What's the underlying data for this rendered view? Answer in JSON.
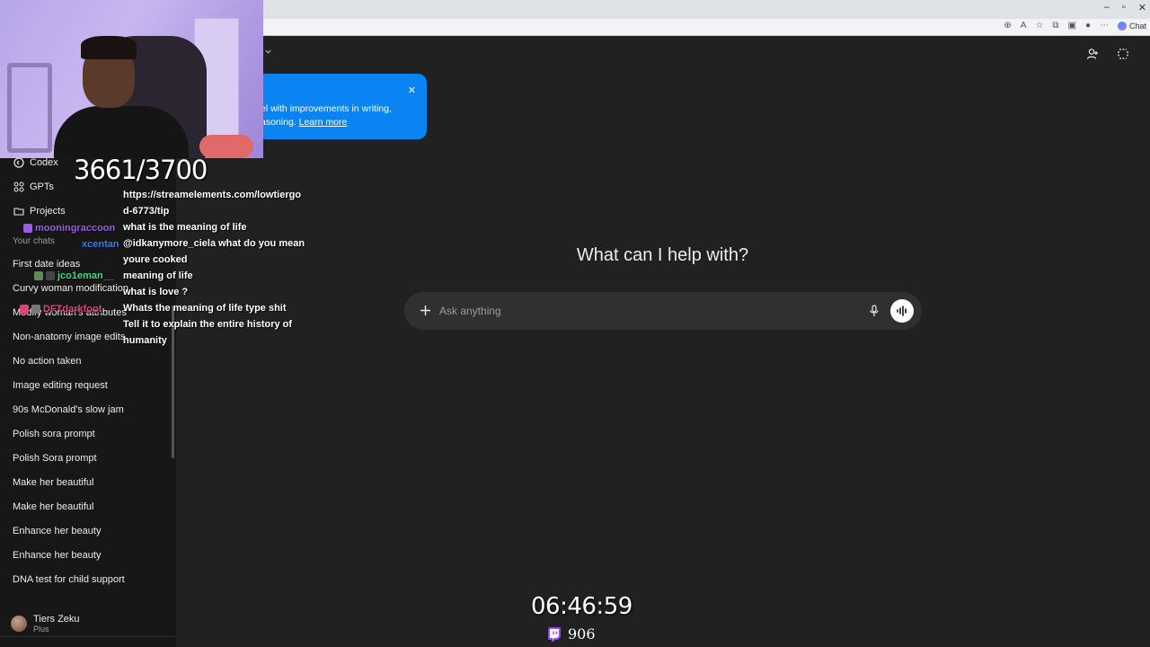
{
  "browser": {
    "window_controls": [
      "–",
      "▫",
      "✕"
    ],
    "chat_button_label": "Chat"
  },
  "sidebar": {
    "nav": [
      {
        "label": "Codex",
        "icon": "codex-icon"
      },
      {
        "label": "GPTs",
        "icon": "gpts-grid-icon"
      },
      {
        "label": "Projects",
        "icon": "folder-icon"
      }
    ],
    "section_title": "Your chats",
    "chats": [
      "First date ideas",
      "Curvy woman modification",
      "Modify woman's attributes",
      "Non-anatomy image edits",
      "No action taken",
      "Image editing request",
      "90s McDonald's slow jam",
      "Polish sora prompt",
      "Polish Sora prompt",
      "Make her beautiful",
      "Make her beautiful",
      "Enhance her beauty",
      "Enhance her beauty",
      "DNA test for child support"
    ],
    "user": {
      "name": "Tiers Zeku",
      "plan": "Plus"
    }
  },
  "banner": {
    "line1": "el with improvements in writing,",
    "line2": "asoning.",
    "link": "Learn more",
    "close_icon": "close-icon",
    "color": "#0b84f3"
  },
  "main": {
    "heading": "What can I help with?",
    "composer": {
      "placeholder": "Ask anything"
    }
  },
  "overlay": {
    "goal_counter": "3661/3700",
    "stream_timer": "06:46:59",
    "viewer_count": "906",
    "chat": {
      "messages": [
        "https://streamelements.com/lowtiergo",
        "d-6773/tip",
        "what is the meaning of life",
        "@idkanymore_ciela what do you mean",
        "youre cooked",
        "meaning of life",
        "what is love ?",
        "Whats the meaning of life type shit",
        "Tell it to explain the entire history of",
        "humanity"
      ],
      "users": [
        {
          "name": "mooningraccoon",
          "color": "#9b5de5"
        },
        {
          "name": "xcentan",
          "color": "#2f80ed"
        },
        {
          "name": "jco1eman__",
          "color": "#3ddc84"
        },
        {
          "name": "DFTdarkfoot",
          "color": "#e0427a"
        }
      ]
    }
  }
}
